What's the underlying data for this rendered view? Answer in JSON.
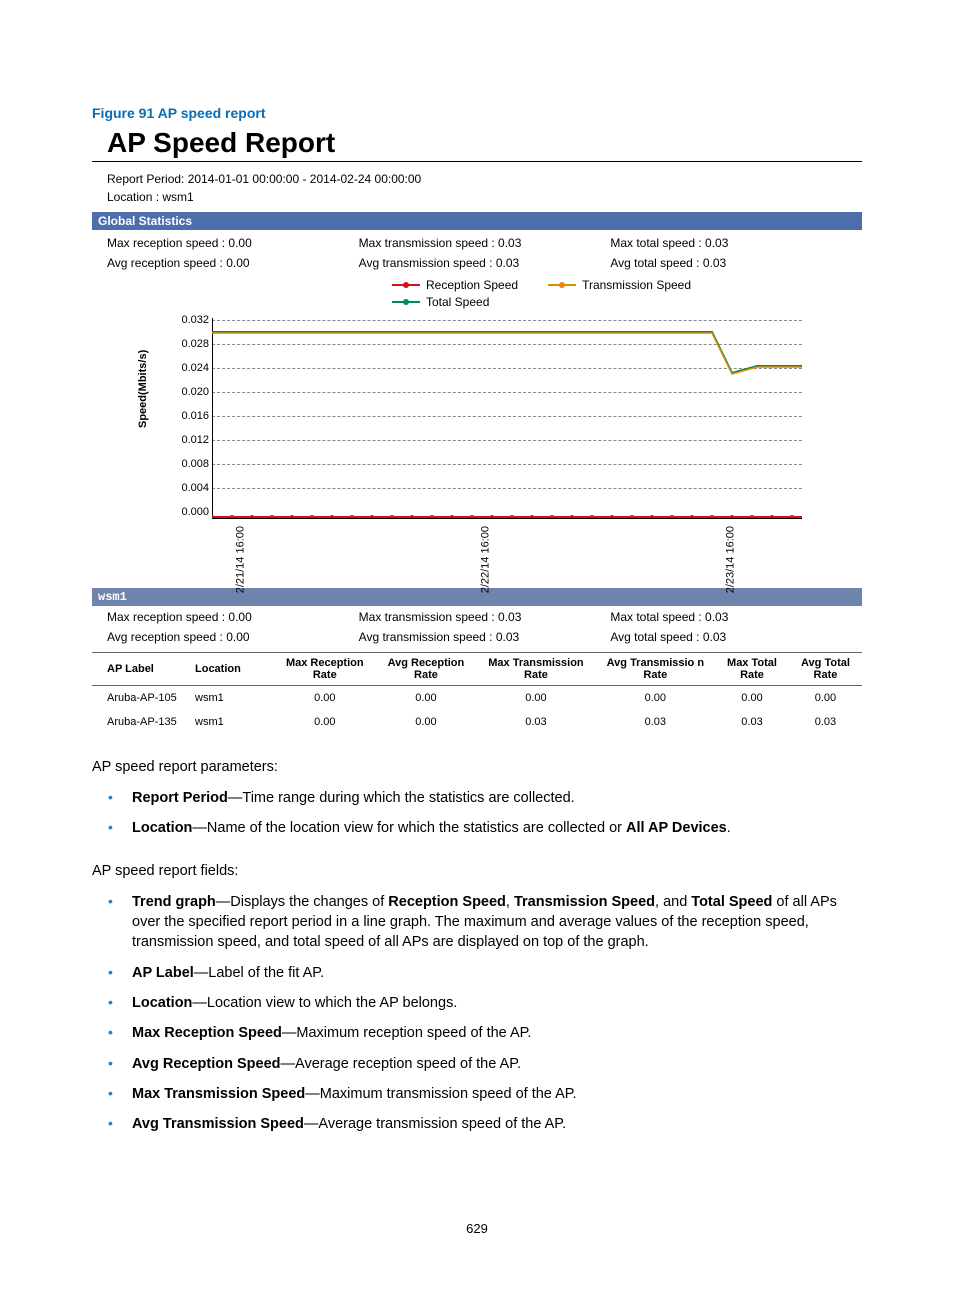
{
  "figure_caption": "Figure 91 AP speed report",
  "report_title": "AP Speed Report",
  "report_period": "Report Period: 2014-01-01 00:00:00 - 2014-02-24 00:00:00",
  "location_line": "Location : wsm1",
  "bar_global": "Global Statistics",
  "global_stats": {
    "max_rx": "Max reception speed : 0.00",
    "max_tx": "Max transmission speed : 0.03",
    "max_tot": "Max total speed : 0.03",
    "avg_rx": "Avg reception speed : 0.00",
    "avg_tx": "Avg transmission speed : 0.03",
    "avg_tot": "Avg total speed : 0.03"
  },
  "legend": {
    "reception": "Reception Speed",
    "transmission": "Transmission Speed",
    "total": "Total Speed"
  },
  "y_label": "Speed(Mbits/s)",
  "y_ticks": [
    "0.032",
    "0.028",
    "0.024",
    "0.020",
    "0.016",
    "0.012",
    "0.008",
    "0.004",
    "0.000"
  ],
  "x_ticks": [
    "2/21/14 16:00",
    "2/22/14 16:00",
    "2/23/14 16:00"
  ],
  "bar_wsm": "wsm1",
  "wsm_stats": {
    "max_rx": "Max reception speed : 0.00",
    "max_tx": "Max transmission speed : 0.03",
    "max_tot": "Max total speed : 0.03",
    "avg_rx": "Avg reception speed : 0.00",
    "avg_tx": "Avg transmission speed : 0.03",
    "avg_tot": "Avg total speed : 0.03"
  },
  "table": {
    "headers": [
      "AP Label",
      "Location",
      "Max Reception Rate",
      "Avg Reception Rate",
      "Max Transmission Rate",
      "Avg Transmissio n Rate",
      "Max Total Rate",
      "Avg Total Rate"
    ],
    "rows": [
      [
        "Aruba-AP-105",
        "wsm1",
        "0.00",
        "0.00",
        "0.00",
        "0.00",
        "0.00",
        "0.00"
      ],
      [
        "Aruba-AP-135",
        "wsm1",
        "0.00",
        "0.00",
        "0.03",
        "0.03",
        "0.03",
        "0.03"
      ]
    ]
  },
  "para_params_intro": "AP speed report parameters:",
  "params": [
    {
      "b": "Report Period",
      "rest": "—Time range during which the statistics are collected."
    },
    {
      "b": "Location",
      "rest": "—Name of the location view for which the statistics are collected or ",
      "b2": "All AP Devices",
      "tail": "."
    }
  ],
  "para_fields_intro": "AP speed report fields:",
  "fields": [
    {
      "pre": "",
      "b": "Trend graph",
      "mid": "—Displays the changes of ",
      "b2": "Reception Speed",
      "mid2": ", ",
      "b3": "Transmission Speed",
      "mid3": ", and ",
      "b4": "Total Speed",
      "tail": " of all APs over the specified report period in a line graph. The maximum and average values of the reception speed, transmission speed, and total speed of all APs are displayed on top of the graph."
    },
    {
      "b": "AP Label",
      "rest": "—Label of the fit AP."
    },
    {
      "b": "Location",
      "rest": "—Location view to which the AP belongs."
    },
    {
      "b": "Max Reception Speed",
      "rest": "—Maximum reception speed of the AP."
    },
    {
      "b": "Avg Reception Speed",
      "rest": "—Average reception speed of the AP."
    },
    {
      "b": "Max Transmission Speed",
      "rest": "—Maximum transmission speed of the AP."
    },
    {
      "b": "Avg Transmission Speed",
      "rest": "—Average transmission speed of the AP."
    }
  ],
  "page_number": "629",
  "chart_data": {
    "type": "line",
    "xlabel": "",
    "ylabel": "Speed(Mbits/s)",
    "ylim": [
      0,
      0.032
    ],
    "x_range": [
      "2014-02-21 16:00",
      "2014-02-23 20:00"
    ],
    "x_ticks": [
      "2/21/14 16:00",
      "2/22/14 16:00",
      "2/23/14 16:00"
    ],
    "series": [
      {
        "name": "Reception Speed",
        "color": "#d1101a",
        "approx_value": 0.0,
        "note": "flat at 0 across full range"
      },
      {
        "name": "Transmission Speed",
        "color": "#e08a00",
        "approx_value": 0.03,
        "note": "≈0.030 most of range, drops & settles ≈0.022 near 2/23/14 ~18:00",
        "end_value": 0.022
      },
      {
        "name": "Total Speed",
        "color": "#008a5a",
        "approx_value": 0.03,
        "note": "≈0.030 most of range, drops & settles ≈0.022 near 2/23/14 ~18:00 (overlaps transmission)",
        "end_value": 0.022
      }
    ]
  }
}
